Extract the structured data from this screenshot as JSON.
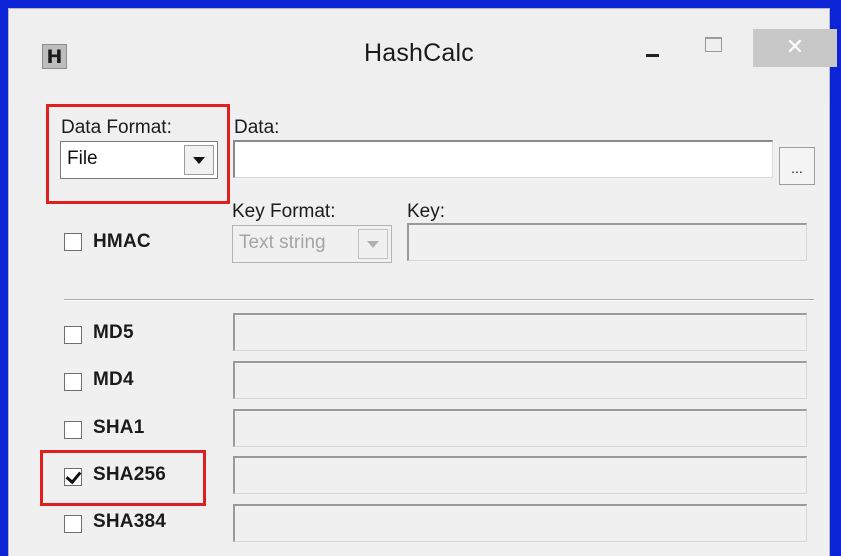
{
  "window": {
    "title": "HashCalc",
    "app_icon_letter": "H",
    "close_glyph": "✕"
  },
  "data_format": {
    "label": "Data Format:",
    "selected": "File"
  },
  "data": {
    "label": "Data:",
    "value": "",
    "browse_label": "..."
  },
  "hmac": {
    "label": "HMAC",
    "checked": false
  },
  "key_format": {
    "label": "Key Format:",
    "selected": "Text string"
  },
  "key": {
    "label": "Key:",
    "value": ""
  },
  "algorithms": [
    {
      "label": "MD5",
      "checked": false,
      "value": ""
    },
    {
      "label": "MD4",
      "checked": false,
      "value": ""
    },
    {
      "label": "SHA1",
      "checked": false,
      "value": ""
    },
    {
      "label": "SHA256",
      "checked": true,
      "value": ""
    },
    {
      "label": "SHA384",
      "checked": false,
      "value": ""
    }
  ],
  "colors": {
    "frame": "#0a24d6",
    "highlight": "#e0201e"
  }
}
